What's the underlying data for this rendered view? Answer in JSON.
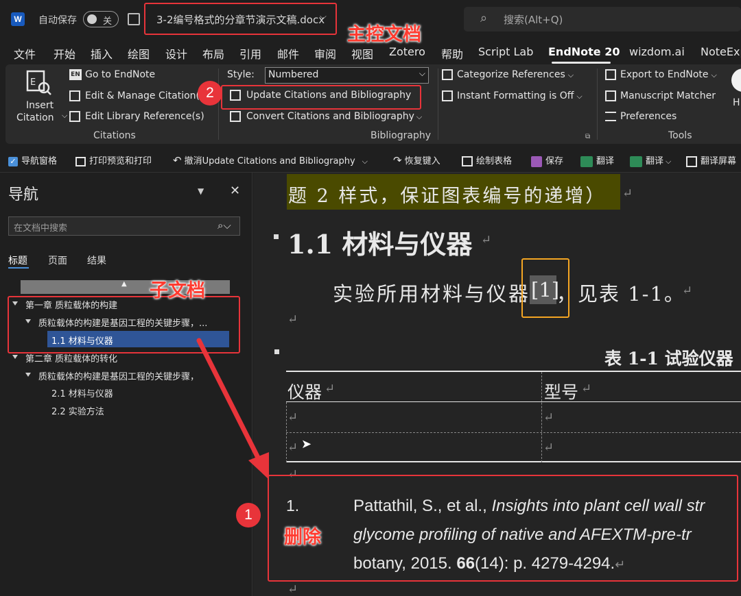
{
  "titlebar": {
    "word_icon": "W",
    "autosave_label": "自动保存",
    "autosave_state": "关",
    "doc_title": "3-2编号格式的分章节演示文稿.docx",
    "search_placeholder": "搜索(Alt+Q)"
  },
  "menu": [
    "文件",
    "开始",
    "插入",
    "绘图",
    "设计",
    "布局",
    "引用",
    "邮件",
    "审阅",
    "视图",
    "Zotero",
    "帮助",
    "Script Lab",
    "EndNote 20",
    "wizdom.ai",
    "NoteExp"
  ],
  "ribbon": {
    "insert_citation_1": "Insert",
    "insert_citation_2": "Citation",
    "go_to_endnote": "Go to EndNote",
    "edit_manage": "Edit & Manage Citation(s)",
    "edit_library": "Edit Library Reference(s)",
    "citations_group": "Citations",
    "style_label": "Style:",
    "style_value": "Numbered",
    "update": "Update Citations and Bibliography",
    "convert": "Convert Citations and Bibliography",
    "bibliography_group": "Bibliography",
    "categorize": "Categorize References",
    "instant": "Instant Formatting is Off",
    "export": "Export to EndNote",
    "manuscript": "Manuscript Matcher",
    "preferences": "Preferences",
    "tools_group": "Tools",
    "cut_h": "H"
  },
  "qat": {
    "nav_pane": "导航窗格",
    "print_preview": "打印预览和打印",
    "undo": "撤消Update Citations and Bibliography",
    "redo": "恢复键入",
    "draw_table": "绘制表格",
    "save": "保存",
    "translate1": "翻译",
    "translate2": "翻译",
    "translate_screen": "翻译屏幕"
  },
  "nav": {
    "title": "导航",
    "search_placeholder": "在文档中搜索",
    "tabs": [
      "标题",
      "页面",
      "结果"
    ],
    "tree": [
      "第一章 质粒载体的构建",
      "质粒载体的构建是基因工程的关键步骤，...",
      "1.1 材料与仪器",
      "第二章 质粒载体的转化",
      "质粒载体的构建是基因工程的关键步骤，",
      "2.1 材料与仪器",
      "2.2 实验方法"
    ]
  },
  "doc": {
    "highlight_line": "题 2 样式，保证图表编号的递增）",
    "heading": "1.1 材料与仪器",
    "body_pre": "实验所用材料与仪器",
    "citation": "[1]",
    "body_post": "，见表 1-1。",
    "table_caption": "表 1-1 试验仪器",
    "table_headers": [
      "仪器",
      "型号"
    ],
    "ref_num": "1.",
    "ref_line1_a": "Pattathil, S., et al., ",
    "ref_line1_b": "Insights into plant cell wall str",
    "ref_line2": "glycome profiling of native and AFEXTM-pre-tr",
    "ref_line3_a": "botany, 2015. ",
    "ref_line3_b": "66",
    "ref_line3_c": "(14): p. 4279-4294."
  },
  "annotations": {
    "master_doc": "主控文档",
    "sub_doc": "子文档",
    "delete": "删除",
    "badge1": "1",
    "badge2": "2"
  },
  "colors": {
    "accent_red": "#e8343a",
    "highlight": "#4a4a00",
    "nav_selected": "#2f5597"
  }
}
